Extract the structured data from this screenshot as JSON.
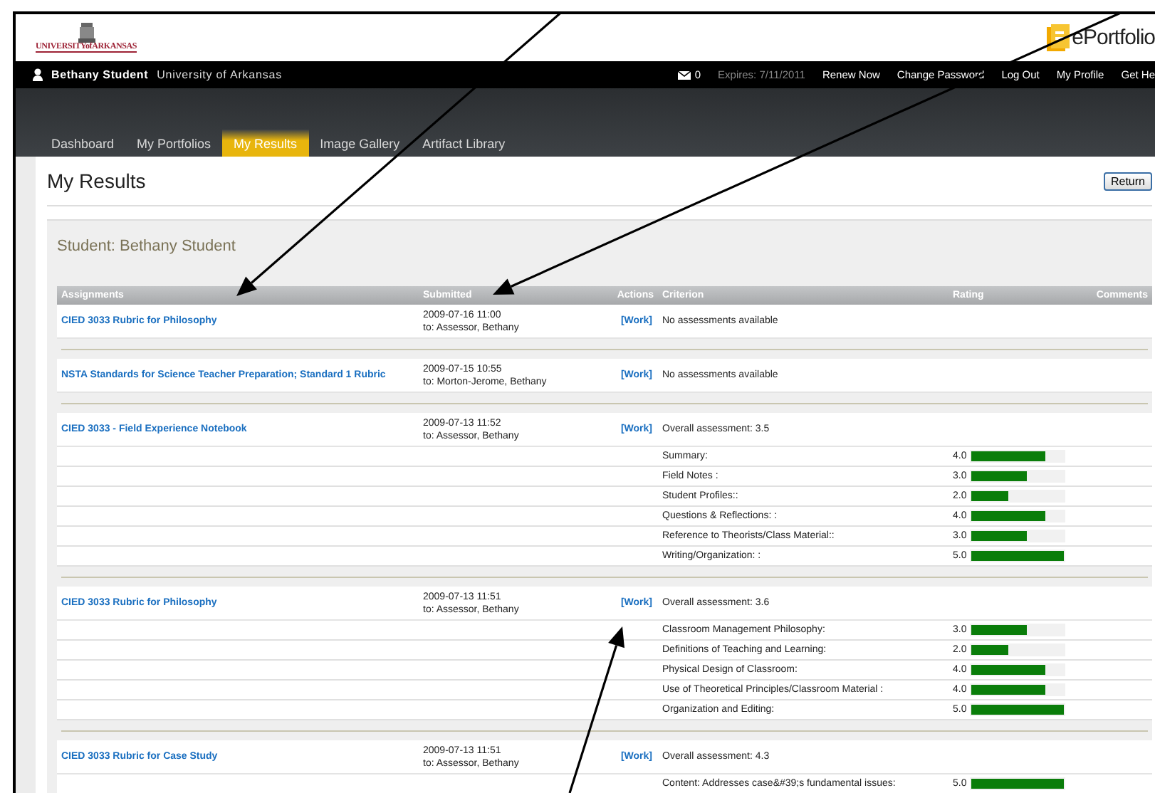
{
  "header": {
    "university_logo": "UNIVERSITYofARKANSAS",
    "product_logo": "ePortfolio"
  },
  "user_bar": {
    "user": "Bethany Student",
    "institution": "University of Arkansas",
    "messages": "0",
    "expires": "Expires: 7/11/2011",
    "links": [
      "Renew Now",
      "Change Password",
      "Log Out",
      "My Profile",
      "Get He"
    ]
  },
  "tabs": [
    {
      "label": "Dashboard",
      "selected": false
    },
    {
      "label": "My Portfolios",
      "selected": false
    },
    {
      "label": "My Results",
      "selected": true
    },
    {
      "label": "Image Gallery",
      "selected": false
    },
    {
      "label": "Artifact Library",
      "selected": false
    }
  ],
  "page": {
    "title": "My Results",
    "return_button": "Return",
    "student": "Student: Bethany Student"
  },
  "table": {
    "columns": [
      "Assignments",
      "Submitted",
      "Actions",
      "Criterion",
      "Rating",
      "Comments"
    ],
    "groups": [
      {
        "assignment": "CIED 3033 Rubric for Philosophy",
        "date": "2009-07-16 11:00",
        "to": "to: Assessor, Bethany",
        "action": "[Work]",
        "summary": "No assessments available"
      },
      {
        "assignment": "NSTA Standards for Science Teacher Preparation; Standard 1 Rubric",
        "date": "2009-07-15 10:55",
        "to": "to: Morton-Jerome, Bethany",
        "action": "[Work]",
        "summary": "No assessments available"
      },
      {
        "assignment": "CIED 3033 - Field Experience Notebook",
        "date": "2009-07-13 11:52",
        "to": "to: Assessor, Bethany",
        "action": "[Work]",
        "summary": "Overall assessment: 3.5",
        "criteria": [
          {
            "name": "Summary:",
            "rating": "4.0",
            "level": 0.8
          },
          {
            "name": "Field Notes :",
            "rating": "3.0",
            "level": 0.6
          },
          {
            "name": "Student Profiles::",
            "rating": "2.0",
            "level": 0.4
          },
          {
            "name": "Questions & Reflections: :",
            "rating": "4.0",
            "level": 0.8
          },
          {
            "name": "Reference to Theorists/Class Material::",
            "rating": "3.0",
            "level": 0.6
          },
          {
            "name": "Writing/Organization: :",
            "rating": "5.0",
            "level": 1
          }
        ]
      },
      {
        "assignment": "CIED 3033 Rubric for Philosophy",
        "date": "2009-07-13 11:51",
        "to": "to: Assessor, Bethany",
        "action": "[Work]",
        "summary": "Overall assessment: 3.6",
        "criteria": [
          {
            "name": "Classroom Management Philosophy:",
            "rating": "3.0",
            "level": 0.6
          },
          {
            "name": "Definitions of Teaching and Learning:",
            "rating": "2.0",
            "level": 0.4
          },
          {
            "name": "Physical Design of Classroom:",
            "rating": "4.0",
            "level": 0.8
          },
          {
            "name": "Use of Theoretical Principles/Classroom Material :",
            "rating": "4.0",
            "level": 0.8
          },
          {
            "name": "Organization and Editing:",
            "rating": "5.0",
            "level": 1
          }
        ]
      },
      {
        "assignment": "CIED 3033 Rubric for Case Study",
        "date": "2009-07-13 11:51",
        "to": "to: Assessor, Bethany",
        "action": "[Work]",
        "summary": "Overall assessment: 4.3",
        "criteria": [
          {
            "name": "Content: Addresses case&#39;s fundamental issues:",
            "rating": "5.0",
            "level": 1
          }
        ]
      }
    ]
  }
}
